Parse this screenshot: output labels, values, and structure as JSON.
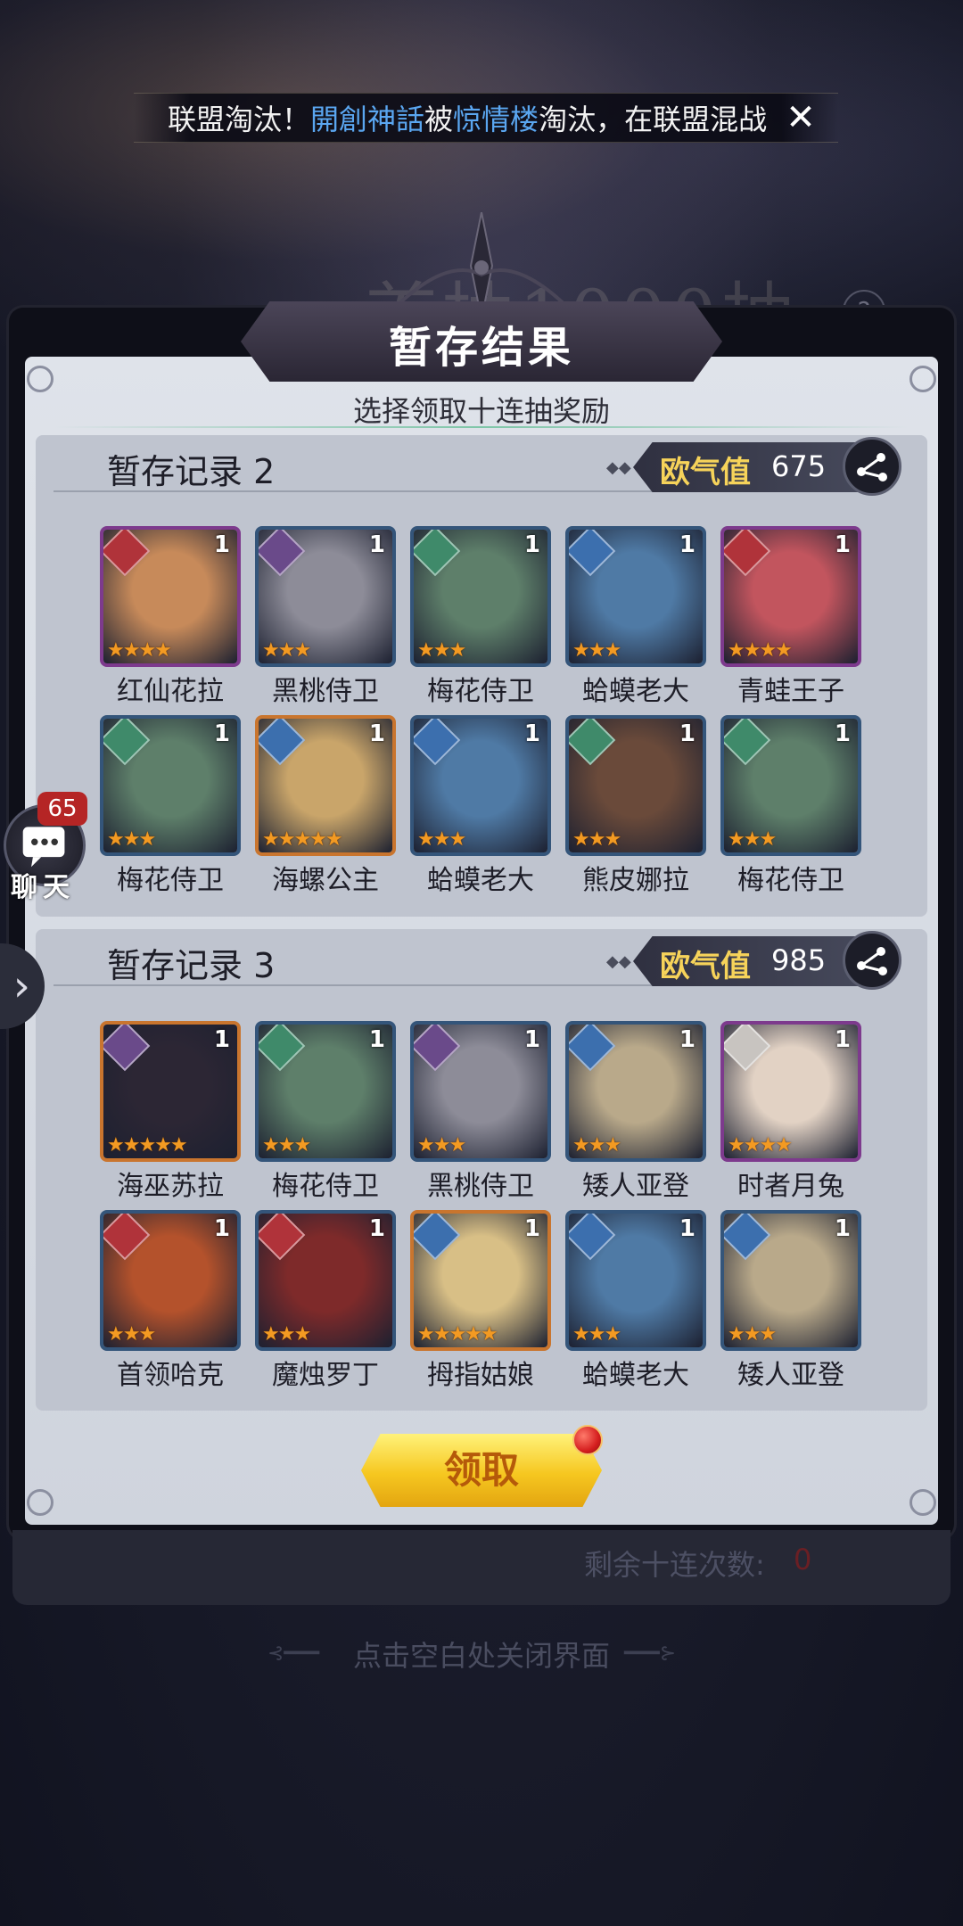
{
  "background": {
    "banner_text": "首抽1000抽"
  },
  "marquee": {
    "prefix": "联盟淘汰！",
    "team_a": "開創神話",
    "middle": "被",
    "team_b": "惊情楼",
    "suffix": "淘汰，在联盟混战"
  },
  "panel": {
    "title": "暂存结果",
    "subtitle": "选择领取十连抽奖励"
  },
  "records": [
    {
      "title": "暂存记录 2",
      "luck_label": "欧气值",
      "luck_value": "675",
      "heroes": [
        {
          "name": "红仙花拉",
          "count": "1",
          "stars": 4,
          "frame": "purple",
          "element": "fire",
          "art": "#c78a5a"
        },
        {
          "name": "黑桃侍卫",
          "count": "1",
          "stars": 3,
          "frame": "blue",
          "element": "dark",
          "art": "#8d8c98"
        },
        {
          "name": "梅花侍卫",
          "count": "1",
          "stars": 3,
          "frame": "blue",
          "element": "wind",
          "art": "#5e7f6a"
        },
        {
          "name": "蛤蟆老大",
          "count": "1",
          "stars": 3,
          "frame": "blue",
          "element": "water",
          "art": "#4f7aa5"
        },
        {
          "name": "青蛙王子",
          "count": "1",
          "stars": 4,
          "frame": "purple",
          "element": "fire",
          "art": "#c2555e"
        },
        {
          "name": "梅花侍卫",
          "count": "1",
          "stars": 3,
          "frame": "blue",
          "element": "wind",
          "art": "#5e7f6a"
        },
        {
          "name": "海螺公主",
          "count": "1",
          "stars": 5,
          "frame": "orange",
          "element": "water",
          "art": "#c9a56a"
        },
        {
          "name": "蛤蟆老大",
          "count": "1",
          "stars": 3,
          "frame": "blue",
          "element": "water",
          "art": "#4f7aa5"
        },
        {
          "name": "熊皮娜拉",
          "count": "1",
          "stars": 3,
          "frame": "blue",
          "element": "wind",
          "art": "#6a4a3a"
        },
        {
          "name": "梅花侍卫",
          "count": "1",
          "stars": 3,
          "frame": "blue",
          "element": "wind",
          "art": "#5e7f6a"
        }
      ]
    },
    {
      "title": "暂存记录 3",
      "luck_label": "欧气值",
      "luck_value": "985",
      "heroes": [
        {
          "name": "海巫苏拉",
          "count": "1",
          "stars": 5,
          "frame": "orange",
          "element": "dark",
          "art": "#2c2634"
        },
        {
          "name": "梅花侍卫",
          "count": "1",
          "stars": 3,
          "frame": "blue",
          "element": "wind",
          "art": "#5e7f6a"
        },
        {
          "name": "黑桃侍卫",
          "count": "1",
          "stars": 3,
          "frame": "blue",
          "element": "dark",
          "art": "#8d8c98"
        },
        {
          "name": "矮人亚登",
          "count": "1",
          "stars": 3,
          "frame": "blue",
          "element": "water",
          "art": "#b9a98a"
        },
        {
          "name": "时者月兔",
          "count": "1",
          "stars": 4,
          "frame": "purple",
          "element": "light",
          "art": "#e2d2c4"
        },
        {
          "name": "首领哈克",
          "count": "1",
          "stars": 3,
          "frame": "blue",
          "element": "fire",
          "art": "#b4522c"
        },
        {
          "name": "魔烛罗丁",
          "count": "1",
          "stars": 3,
          "frame": "blue",
          "element": "fire",
          "art": "#7e2a2a"
        },
        {
          "name": "拇指姑娘",
          "count": "1",
          "stars": 5,
          "frame": "orange",
          "element": "water",
          "art": "#d8bf86"
        },
        {
          "name": "蛤蟆老大",
          "count": "1",
          "stars": 3,
          "frame": "blue",
          "element": "water",
          "art": "#4f7aa5"
        },
        {
          "name": "矮人亚登",
          "count": "1",
          "stars": 3,
          "frame": "blue",
          "element": "water",
          "art": "#b9a98a"
        }
      ]
    }
  ],
  "claim_button": {
    "label": "领取"
  },
  "remaining": {
    "label": "剩余十连次数:",
    "value": "0"
  },
  "close_hint": "点击空白处关闭界面",
  "chat": {
    "label": "聊天",
    "badge": "65"
  },
  "colors": {
    "luck_label": "#f6d35a",
    "marquee_highlight": "#5aa6f0",
    "star": "#f39a22",
    "claim_button": "#f6c720"
  }
}
